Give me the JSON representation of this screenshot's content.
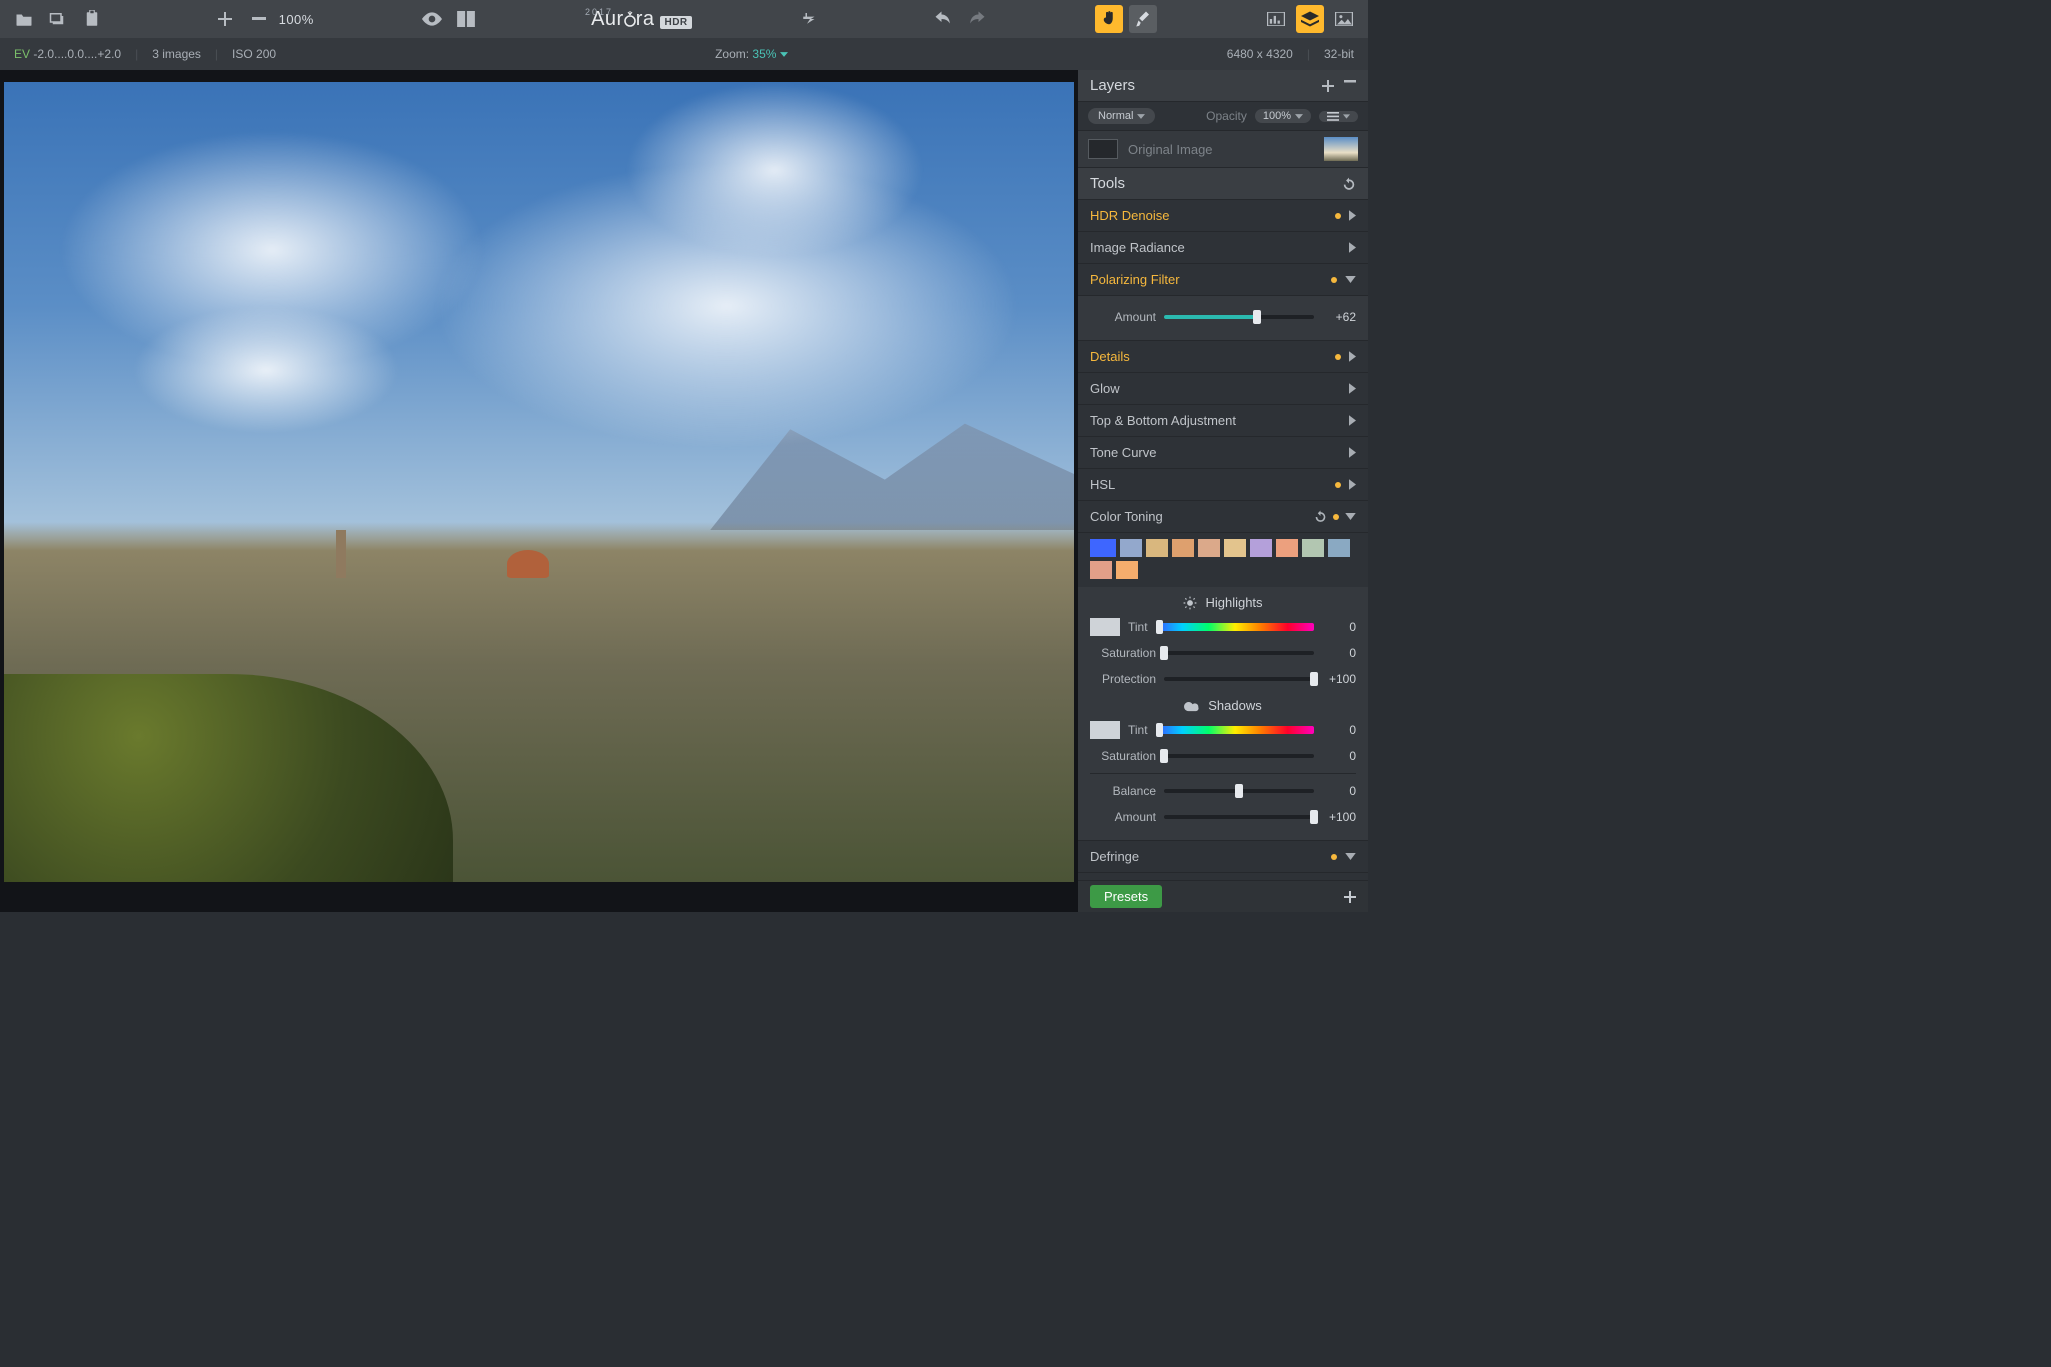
{
  "app": {
    "name_prefix": "Aur",
    "name_suffix": "ra",
    "year": "2017",
    "badge": "HDR"
  },
  "topbar": {
    "zoom_pct": "100%"
  },
  "infobar": {
    "ev_label": "EV",
    "ev_val": "-2.0....0.0....+2.0",
    "images": "3 images",
    "iso": "ISO 200",
    "zoom_label": "Zoom:",
    "zoom_val": "35%",
    "dims": "6480 x 4320",
    "bits": "32-bit"
  },
  "layers": {
    "title": "Layers",
    "blend_mode": "Normal",
    "opacity_label": "Opacity",
    "opacity_val": "100%",
    "item": {
      "name": "Original Image"
    }
  },
  "tools": {
    "title": "Tools",
    "hdr_denoise": "HDR Denoise",
    "image_radiance": "Image Radiance",
    "polarizing": {
      "title": "Polarizing Filter",
      "amount_label": "Amount",
      "amount_val": "+62"
    },
    "details": "Details",
    "glow": "Glow",
    "top_bottom": "Top & Bottom Adjustment",
    "tone_curve": "Tone Curve",
    "hsl": "HSL",
    "color_toning": {
      "title": "Color Toning",
      "highlights": "Highlights",
      "shadows": "Shadows",
      "tint": "Tint",
      "saturation": "Saturation",
      "protection": "Protection",
      "balance": "Balance",
      "amount": "Amount",
      "tint_val": "0",
      "sat_val": "0",
      "protection_val": "+100",
      "balance_val": "0",
      "amount_val": "+100",
      "swatches": [
        "#3e66ff",
        "#93a8cc",
        "#d9b77e",
        "#dea06e",
        "#dba98a",
        "#e3c48d",
        "#b4a0da",
        "#eca07e",
        "#b2c6b1",
        "#8aa9c2",
        "#e29f88",
        "#f5ad6d"
      ]
    },
    "defringe": "Defringe"
  },
  "presets": {
    "label": "Presets"
  }
}
